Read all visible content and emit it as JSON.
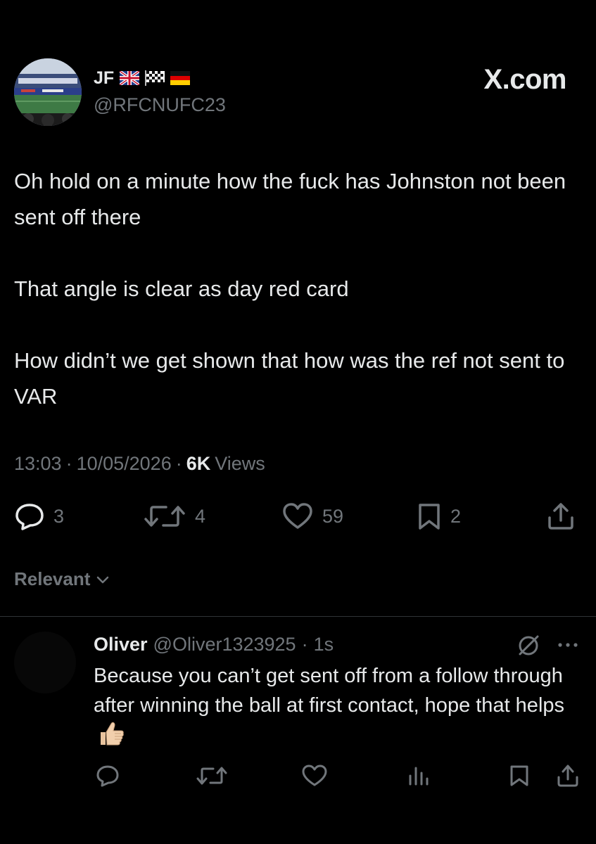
{
  "header": {
    "display_name": "JF",
    "flags": [
      "uk-flag",
      "checkered-flag",
      "germany-flag"
    ],
    "handle": "@RFCNUFC23",
    "brand": "X.com"
  },
  "tweet": {
    "paragraphs": [
      "Oh hold on a minute how the fuck has Johnston not been sent off there",
      "That angle is clear as day red card",
      "How didn’t we get shown that how was the ref not sent to VAR"
    ],
    "time": "13:03",
    "date": "10/05/2026",
    "views_count": "6K",
    "views_label": "Views",
    "separator": "·",
    "actions": {
      "replies": "3",
      "reposts": "4",
      "likes": "59",
      "bookmarks": "2"
    }
  },
  "sort": {
    "label": "Relevant"
  },
  "reply": {
    "name": "Oliver",
    "handle": "@Oliver1323925",
    "separator": "·",
    "time": "1s",
    "text": "Because you can’t get sent off from a follow through after winning the ball at first contact, hope that helps",
    "emoji": "thumbs-up"
  },
  "colors": {
    "background": "#000000",
    "text": "#e7e9ea",
    "muted": "#71767b",
    "divider": "#2f3336"
  }
}
